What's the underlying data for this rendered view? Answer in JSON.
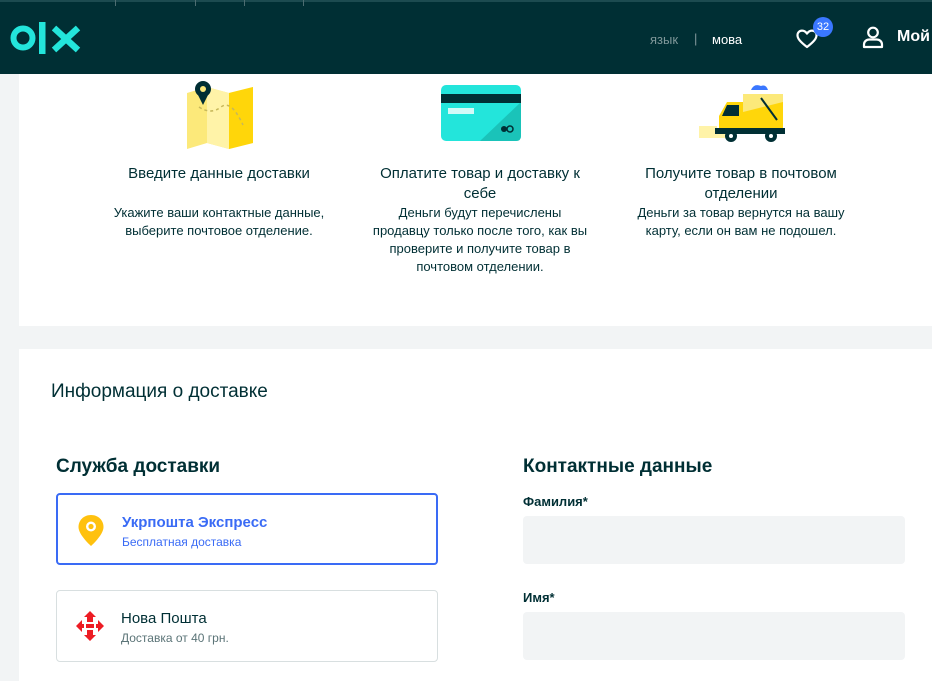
{
  "header": {
    "lang_ru": "язык",
    "lang_separator": "|",
    "lang_ua": "мова",
    "favorites_count": "32",
    "account_label": "Мой"
  },
  "steps": [
    {
      "icon": "map-pin-icon",
      "title": "Введите данные доставки",
      "description": "Укажите ваши контактные данные, выберите почтовое отделение."
    },
    {
      "icon": "credit-card-icon",
      "title": "Оплатите товар и доставку к себе",
      "description": "Деньги будут перечислены продавцу только после того, как вы проверите и получите товар в почтовом отделении."
    },
    {
      "icon": "delivery-truck-icon",
      "title": "Получите товар в почтовом отделении",
      "description": "Деньги за товар вернутся на вашу карту, если он вам не подошел."
    }
  ],
  "delivery": {
    "section_title": "Информация о доставке",
    "service_title": "Служба доставки",
    "options": [
      {
        "name": "Укрпошта Экспресс",
        "subtitle": "Бесплатная доставка",
        "selected": true
      },
      {
        "name": "Нова Пошта",
        "subtitle": "Доставка от 40 грн.",
        "selected": false
      }
    ],
    "contacts_title": "Контактные данные",
    "fields": [
      {
        "label": "Фамилия*",
        "value": ""
      },
      {
        "label": "Имя*",
        "value": ""
      }
    ]
  },
  "colors": {
    "header_bg": "#002f34",
    "brand_teal": "#23e5db",
    "accent_blue": "#3a6bf5",
    "badge_blue": "#3a77ff",
    "ukrposhta_yellow": "#ffc10e",
    "novaposhta_red": "#ed1c24"
  }
}
